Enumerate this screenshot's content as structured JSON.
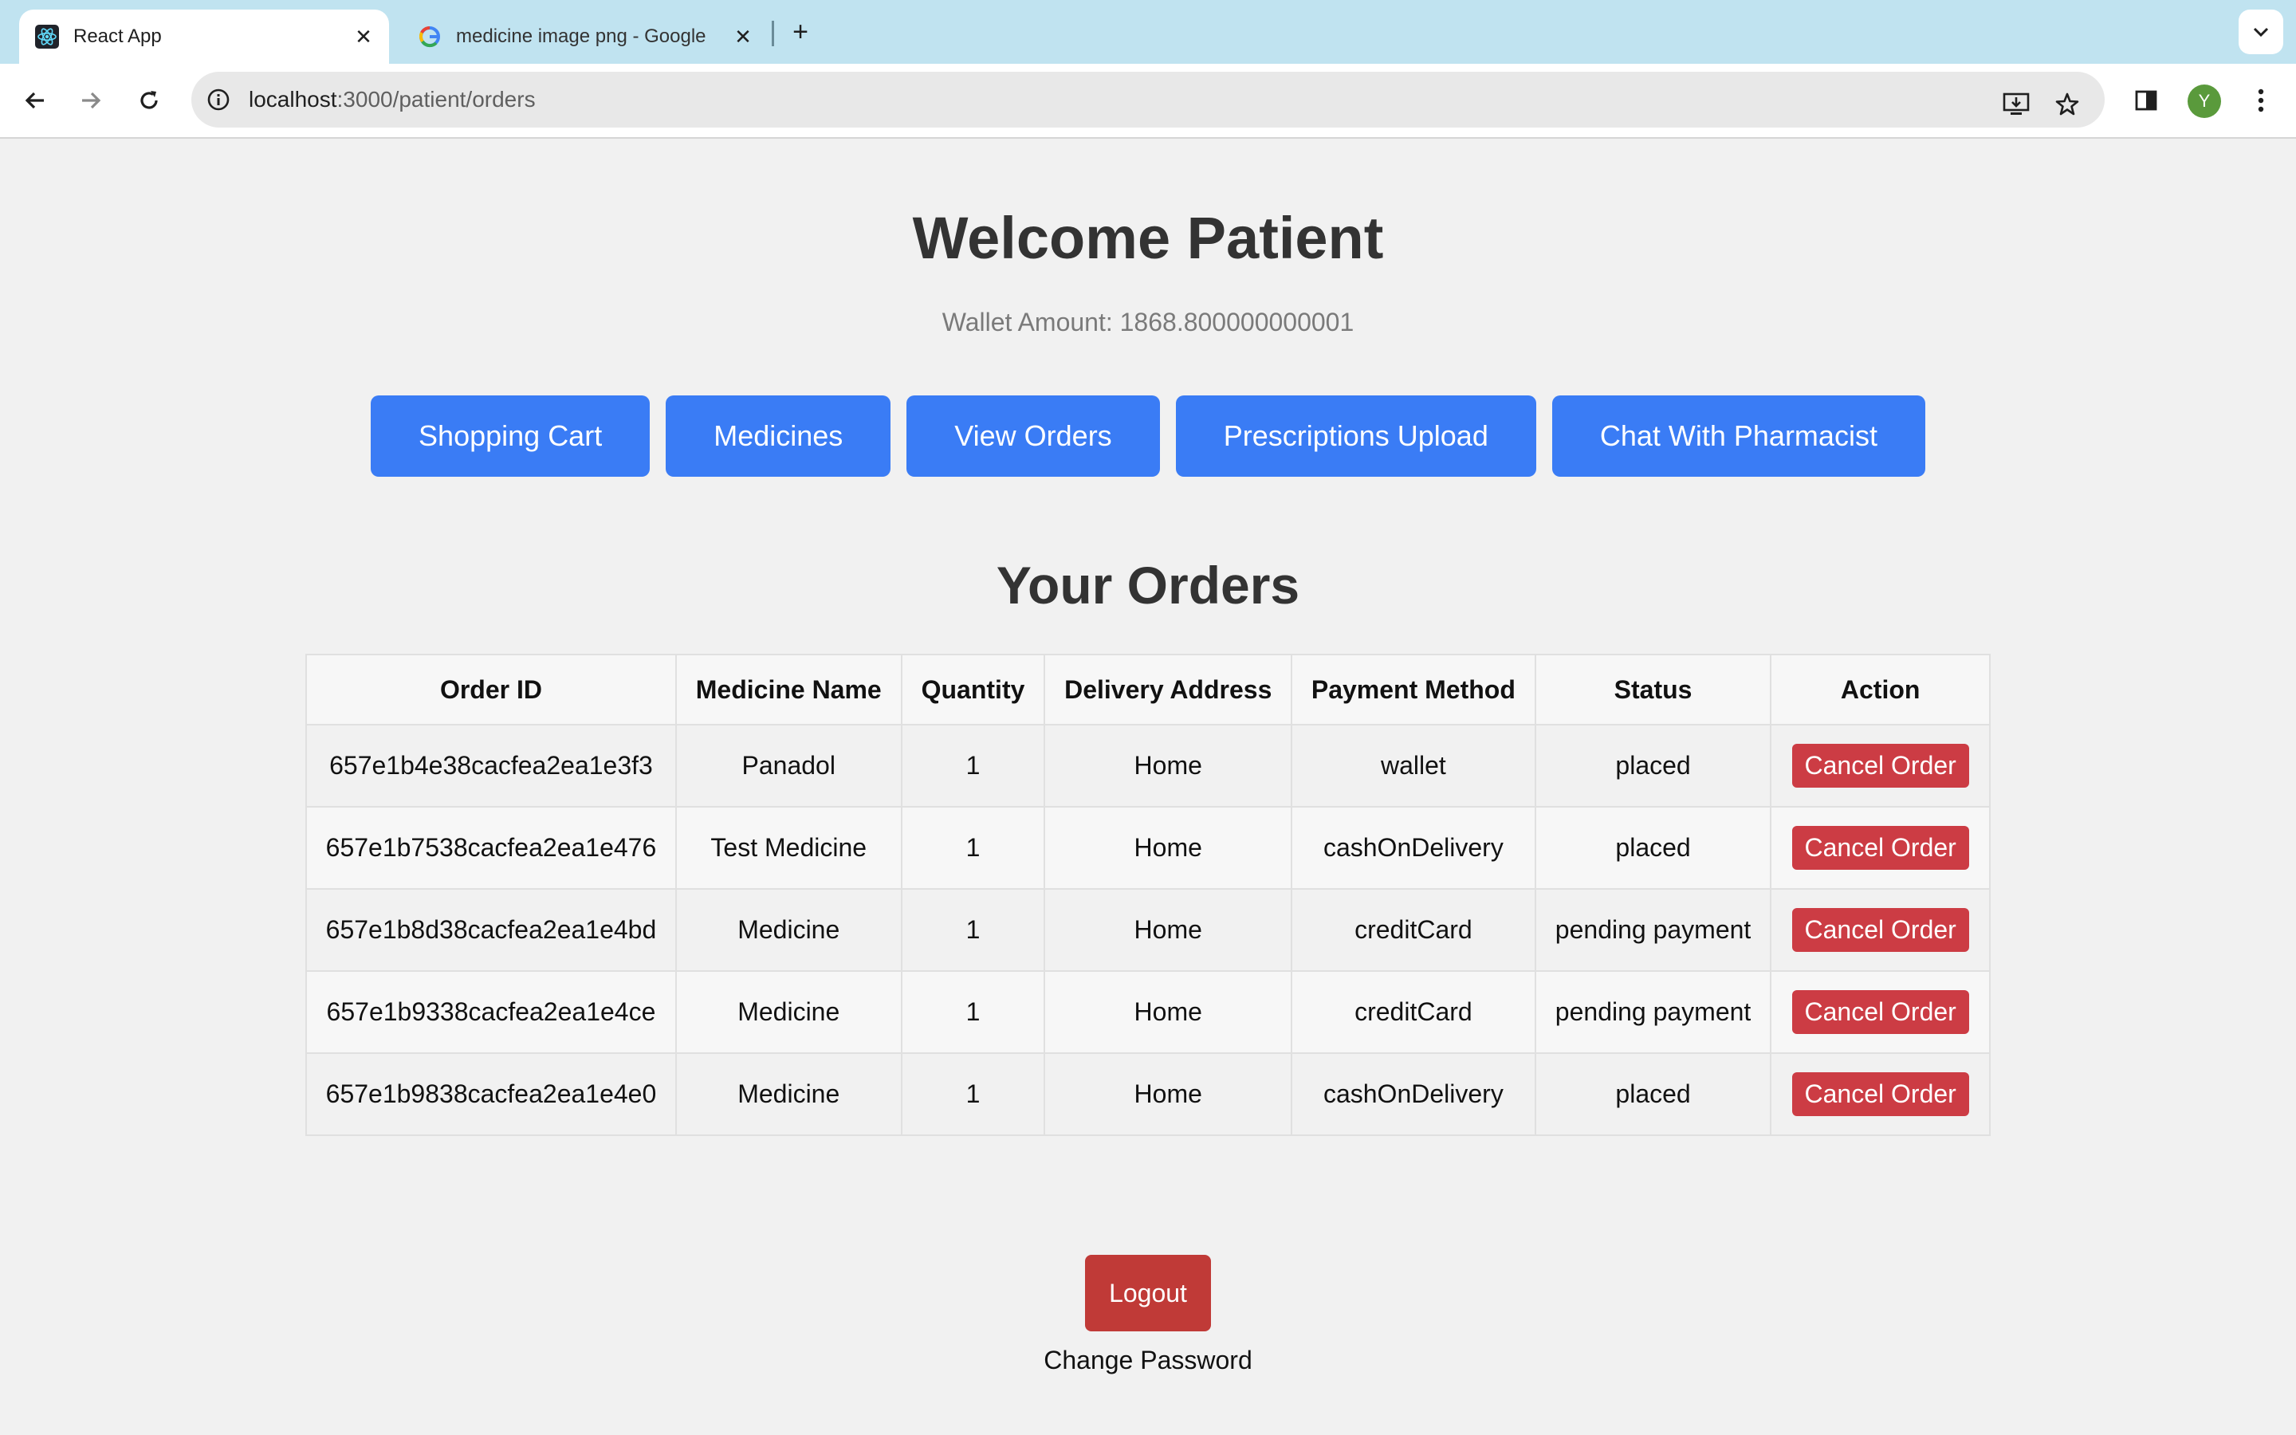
{
  "browser": {
    "tabs": [
      {
        "title": "React App",
        "icon": "react-icon"
      },
      {
        "title": "medicine image png - Google",
        "icon": "google-icon"
      }
    ],
    "url_host": "localhost",
    "url_path": ":3000/patient/orders"
  },
  "header": {
    "title": "Welcome Patient",
    "wallet_label": "Wallet Amount:",
    "wallet_value": "1868.800000000001"
  },
  "nav": {
    "buttons": [
      "Shopping Cart",
      "Medicines",
      "View Orders",
      "Prescriptions Upload",
      "Chat With Pharmacist"
    ]
  },
  "orders": {
    "title": "Your Orders",
    "columns": [
      "Order ID",
      "Medicine Name",
      "Quantity",
      "Delivery Address",
      "Payment Method",
      "Status",
      "Action"
    ],
    "rows": [
      {
        "id": "657e1b4e38cacfea2ea1e3f3",
        "medicine": "Panadol",
        "quantity": "1",
        "address": "Home",
        "payment": "wallet",
        "status": "placed",
        "action": "Cancel Order"
      },
      {
        "id": "657e1b7538cacfea2ea1e476",
        "medicine": "Test Medicine",
        "quantity": "1",
        "address": "Home",
        "payment": "cashOnDelivery",
        "status": "placed",
        "action": "Cancel Order"
      },
      {
        "id": "657e1b8d38cacfea2ea1e4bd",
        "medicine": "Medicine",
        "quantity": "1",
        "address": "Home",
        "payment": "creditCard",
        "status": "pending payment",
        "action": "Cancel Order"
      },
      {
        "id": "657e1b9338cacfea2ea1e4ce",
        "medicine": "Medicine",
        "quantity": "1",
        "address": "Home",
        "payment": "creditCard",
        "status": "pending payment",
        "action": "Cancel Order"
      },
      {
        "id": "657e1b9838cacfea2ea1e4e0",
        "medicine": "Medicine",
        "quantity": "1",
        "address": "Home",
        "payment": "cashOnDelivery",
        "status": "placed",
        "action": "Cancel Order"
      }
    ]
  },
  "footer": {
    "logout": "Logout",
    "change_password": "Change Password"
  },
  "profile": {
    "initial": "Y"
  },
  "colors": {
    "primary_button": "#3a7cf5",
    "cancel_button": "#cc3c44",
    "logout_button": "#c03a37"
  }
}
